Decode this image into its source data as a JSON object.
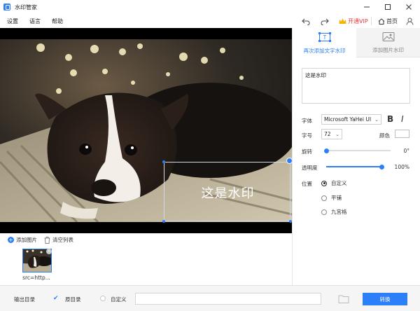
{
  "app": {
    "title": "水印管家",
    "icon": "app-logo-icon"
  },
  "window_controls": [
    "minimize-icon",
    "maximize-icon",
    "close-icon"
  ],
  "menu": [
    "设置",
    "语言",
    "帮助"
  ],
  "toolbar": {
    "undo_icon": "undo-icon",
    "redo_icon": "redo-icon",
    "vip_label": "开通VIP",
    "home_label": "首页",
    "user_icon": "user-icon",
    "vip_color": "#e53935",
    "accent_color": "#2d7ff9"
  },
  "canvas": {
    "watermark_text": "这是水印"
  },
  "panel": {
    "tabs": [
      {
        "label": "再次添加文字水印",
        "icon": "text-watermark-icon",
        "active": true
      },
      {
        "label": "添加图片水印",
        "icon": "image-watermark-icon",
        "active": false
      }
    ],
    "watermark_input": "这是水印",
    "font": {
      "label": "字体",
      "value": "Microsoft YaHei UI",
      "bold": "B",
      "italic": "I"
    },
    "size": {
      "label": "字号",
      "value": "72"
    },
    "color": {
      "label": "颜色",
      "value": "#ffffff"
    },
    "rotation": {
      "label": "旋转",
      "value": "0°",
      "fraction": 0.0
    },
    "opacity": {
      "label": "透明度",
      "value": "100%",
      "fraction": 1.0
    },
    "position": {
      "label": "位置",
      "options": [
        {
          "label": "自定义",
          "checked": true
        },
        {
          "label": "平铺",
          "checked": false
        },
        {
          "label": "九宫格",
          "checked": false
        }
      ]
    }
  },
  "list": {
    "add_label": "添加图片",
    "clear_label": "清空列表",
    "items": [
      {
        "caption": "src=http..."
      }
    ]
  },
  "bottom": {
    "output_label": "输出目录",
    "original_label": "原目录",
    "original_checked": true,
    "custom_label": "自定义",
    "path_value": "",
    "convert_label": "转换"
  }
}
